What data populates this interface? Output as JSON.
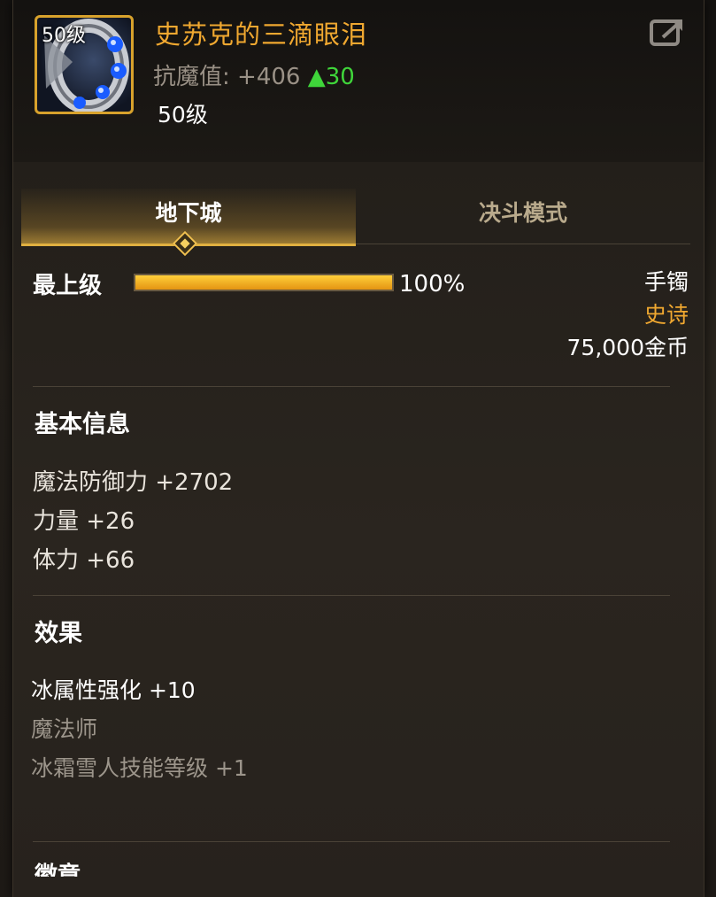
{
  "item": {
    "icon_level": "50级",
    "name": "史苏克的三滴眼泪",
    "stat_label": "抗魔值:",
    "stat_value": "+406",
    "stat_increase": "▲30",
    "level": "50级",
    "share_icon": "share-export-icon"
  },
  "tabs": [
    {
      "label": "地下城",
      "active": true
    },
    {
      "label": "决斗模式",
      "active": false
    }
  ],
  "grade": {
    "label": "最上级",
    "progress_percent": 100,
    "percent_text": "100%"
  },
  "details": {
    "type": "手镯",
    "rarity": "史诗",
    "price": "75,000金币"
  },
  "basic_info": {
    "title": "基本信息",
    "stats": [
      "魔法防御力 +2702",
      "力量 +26",
      "体力 +66"
    ]
  },
  "effects": {
    "title": "效果",
    "main": "冰属性强化 +10",
    "class": "魔法师",
    "skill": "冰霜雪人技能等级 +1"
  },
  "next_section": {
    "title": "徽章"
  },
  "colors": {
    "item_name": "#f0a830",
    "rarity": "#f0a830",
    "increase": "#3fd53a",
    "tab_accent": "#e0b040"
  }
}
